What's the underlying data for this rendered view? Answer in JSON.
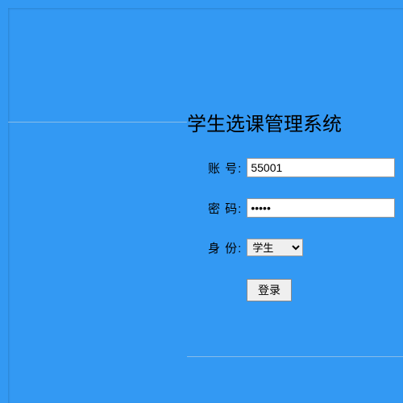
{
  "title": "学生选课管理系统",
  "form": {
    "account": {
      "label": "账  号:",
      "value": "55001"
    },
    "password": {
      "label": "密  码:",
      "value": "•••••"
    },
    "role": {
      "label": "身  份:",
      "selected": "学生"
    },
    "login_label": "登录"
  }
}
